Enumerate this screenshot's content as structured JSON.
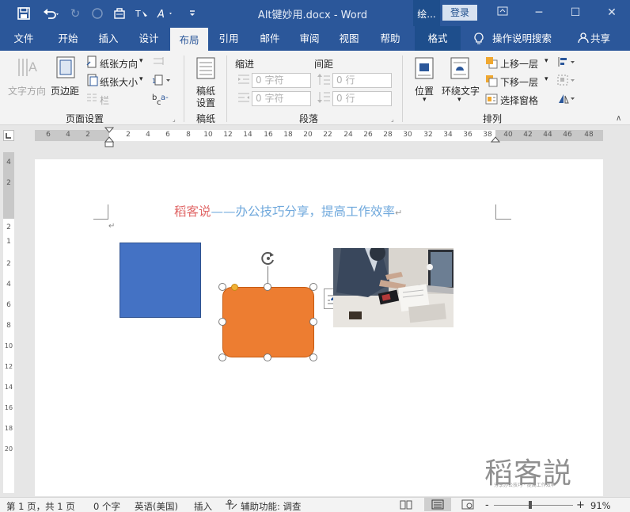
{
  "titlebar": {
    "doc_title": "Alt键妙用.docx  -  Word",
    "context_tab": "绘...",
    "login": "登录",
    "accent": "#2b579a"
  },
  "tabs": [
    {
      "label": "文件"
    },
    {
      "label": "开始"
    },
    {
      "label": "插入"
    },
    {
      "label": "设计"
    },
    {
      "label": "布局"
    },
    {
      "label": "引用"
    },
    {
      "label": "邮件"
    },
    {
      "label": "审阅"
    },
    {
      "label": "视图"
    },
    {
      "label": "帮助"
    },
    {
      "label": "格式"
    },
    {
      "label": "操作说明搜索"
    },
    {
      "label": "共享"
    }
  ],
  "ribbon": {
    "text_direction": "文字方向",
    "margins": "页边距",
    "orientation": "纸张方向",
    "size": "纸张大小",
    "columns": "栏",
    "page_setup_group": "页面设置",
    "draft_paper": "稿纸\n设置",
    "draft_line1": "稿纸",
    "draft_line2": "设置",
    "draft_group": "稿纸",
    "indent": "缩进",
    "spacing": "间距",
    "indent_left": "0 字符",
    "indent_right": "0 字符",
    "spacing_before": "0 行",
    "spacing_after": "0 行",
    "paragraph_group": "段落",
    "position": "位置",
    "wrap_text": "环绕文字",
    "bring_forward": "上移一层",
    "send_backward": "下移一层",
    "selection_pane": "选择窗格",
    "arrange_group": "排列"
  },
  "ruler": {
    "h_ticks": [
      "6",
      "4",
      "2",
      "2",
      "4",
      "6",
      "8",
      "10",
      "12",
      "14",
      "16",
      "18",
      "20",
      "22",
      "24",
      "26",
      "28",
      "30",
      "32",
      "34",
      "36",
      "38",
      "40",
      "42",
      "44",
      "46",
      "48"
    ],
    "v_ticks": [
      "4",
      "2",
      "2",
      "1",
      "2",
      "4",
      "6",
      "8",
      "10",
      "12",
      "14",
      "16",
      "18",
      "20"
    ]
  },
  "document": {
    "header_part1": "稻客说",
    "header_part2": "——办公技巧分享，提高工作效率",
    "para_mark": "↵",
    "watermark_logo": "稻客説",
    "watermark_sub": "分享办公技巧 · 提高工作效率",
    "blue_color": "#4472c4",
    "orange_color": "#ed7d31"
  },
  "statusbar": {
    "page": "第 1 页，共 1 页",
    "words": "0 个字",
    "language": "英语(美国)",
    "insert": "插入",
    "accessibility": "辅助功能: 调查",
    "zoom_minus": "-",
    "zoom_plus": "+",
    "zoom": "91%"
  }
}
